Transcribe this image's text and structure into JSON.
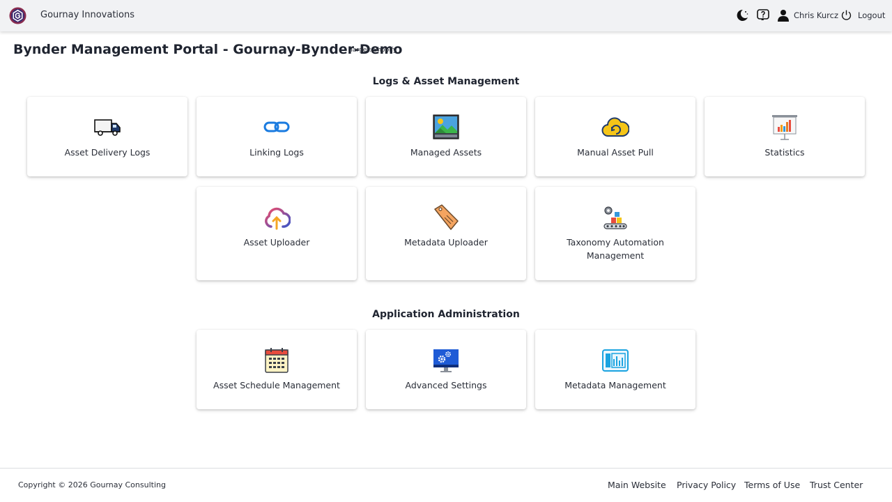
{
  "header": {
    "brand_name": "Gournay Innovations",
    "user_name": "Chris Kurcz",
    "logout_label": "Logout"
  },
  "page": {
    "title": "Bynder Management Portal - Gournay-Bynder-Demo",
    "target": "Target: Shopify"
  },
  "sections": {
    "logs_title": "Logs & Asset Management",
    "admin_title": "Application Administration"
  },
  "cards": {
    "asset_delivery_logs": "Asset Delivery Logs",
    "linking_logs": "Linking Logs",
    "managed_assets": "Managed Assets",
    "manual_asset_pull": "Manual Asset Pull",
    "statistics": "Statistics",
    "asset_uploader": "Asset Uploader",
    "metadata_uploader": "Metadata Uploader",
    "taxonomy_automation": "Taxonomy Automation Management",
    "asset_schedule": "Asset Schedule Management",
    "advanced_settings": "Advanced Settings",
    "metadata_management": "Metadata Management"
  },
  "footer": {
    "copyright": "Copyright © 2026 Gournay Consulting",
    "links": [
      "Main Website",
      "Privacy Policy",
      "Terms of Use",
      "Trust Center"
    ]
  },
  "colors": {
    "topbar_bg": "#f1f2f4",
    "text": "#1f2430",
    "card_bg": "#ffffff"
  }
}
